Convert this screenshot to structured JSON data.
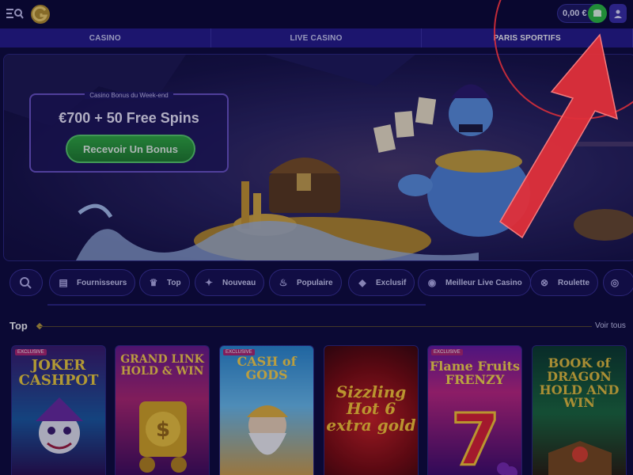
{
  "header": {
    "balance": "0,00 €"
  },
  "nav": {
    "tabs": [
      {
        "label": "CASINO"
      },
      {
        "label": "LIVE CASINO"
      },
      {
        "label": "PARIS SPORTIFS"
      }
    ]
  },
  "hero": {
    "kicker": "Casino Bonus du Week-end",
    "title": "€700 + 50 Free Spins",
    "button": "Recevoir Un Bonus"
  },
  "categories": [
    {
      "label": "",
      "icon": "search-icon"
    },
    {
      "label": "Fournisseurs",
      "icon": "providers-icon"
    },
    {
      "label": "Top",
      "icon": "crown-icon"
    },
    {
      "label": "Nouveau",
      "icon": "sparkle-icon"
    },
    {
      "label": "Populaire",
      "icon": "fire-icon"
    },
    {
      "label": "Exclusif",
      "icon": "diamond-icon"
    },
    {
      "label": "Meilleur Live Casino",
      "icon": "live-icon"
    },
    {
      "label": "Roulette",
      "icon": "roulette-icon"
    }
  ],
  "top_section": {
    "title": "Top",
    "see_all": "Voir tous"
  },
  "games": [
    {
      "title": "JOKER CASHPOT",
      "badge": "EXCLUSIVE"
    },
    {
      "title": "GRAND LINK HOLD & WIN",
      "badge": ""
    },
    {
      "title": "CASH of GODS",
      "badge": "EXCLUSIVE"
    },
    {
      "title": "Sizzling Hot 6 extra gold",
      "badge": ""
    },
    {
      "title": "Flame Fruits FRENZY",
      "badge": "EXCLUSIVE"
    },
    {
      "title": "BOOK of DRAGON HOLD AND WIN",
      "badge": ""
    }
  ],
  "colors": {
    "background": "#0d0a3a",
    "nav": "#241b8a",
    "accent_green": "#2bbf3f",
    "annotation_red": "#e0303a"
  }
}
